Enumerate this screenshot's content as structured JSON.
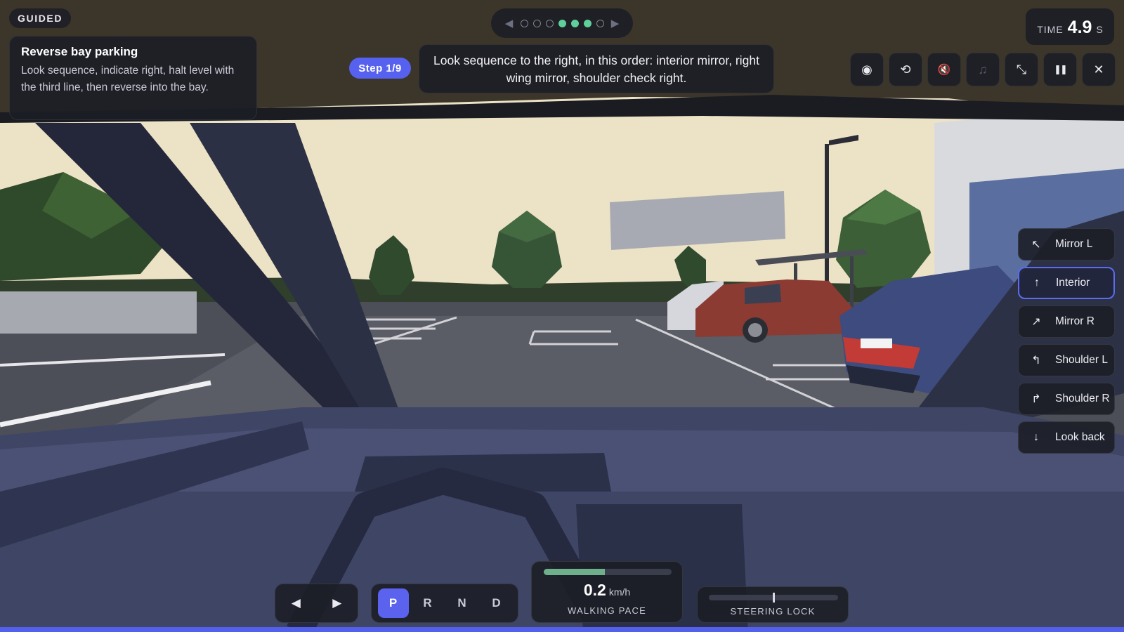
{
  "mode_label": "GUIDED",
  "task": {
    "title": "Reverse bay parking",
    "description": "Look sequence, indicate right, halt level with the third line, then reverse into the bay."
  },
  "stepper": {
    "prev_icon": "◀",
    "next_icon": "▶",
    "dots": [
      "pending",
      "pending",
      "pending",
      "done",
      "done",
      "done",
      "pending"
    ]
  },
  "step_badge": "Step 1/9",
  "instruction": "Look sequence to the right, in this order: interior mirror, right wing mirror, shoulder check right.",
  "timer": {
    "label": "TIME",
    "value": "4.9",
    "unit": "S"
  },
  "toolbar": [
    {
      "name": "camera-icon",
      "glyph": "◉",
      "dim": false
    },
    {
      "name": "reset-icon",
      "glyph": "⟲",
      "dim": false
    },
    {
      "name": "horn-muted-icon",
      "glyph": "🔇",
      "dim": false
    },
    {
      "name": "music-icon",
      "glyph": "♫",
      "dim": true
    },
    {
      "name": "collapse-icon",
      "glyph": "⤡",
      "dim": false
    },
    {
      "name": "pause-icon",
      "glyph": "❚❚",
      "dim": false
    },
    {
      "name": "close-icon",
      "glyph": "✕",
      "dim": false
    }
  ],
  "look_buttons": [
    {
      "label": "Mirror L",
      "icon": "↖",
      "active": false
    },
    {
      "label": "Interior",
      "icon": "↑",
      "active": true
    },
    {
      "label": "Mirror R",
      "icon": "↗",
      "active": false
    },
    {
      "label": "Shoulder L",
      "icon": "↰",
      "active": false
    },
    {
      "label": "Shoulder R",
      "icon": "↱",
      "active": false
    },
    {
      "label": "Look back",
      "icon": "↓",
      "active": false
    }
  ],
  "steer_arrows": {
    "left": "◀",
    "right": "▶"
  },
  "gears": {
    "items": [
      "P",
      "R",
      "N",
      "D"
    ],
    "selected": "P"
  },
  "speed": {
    "value": "0.2",
    "unit": "km/h",
    "caption": "WALKING PACE",
    "bar_fraction": 0.48
  },
  "steering": {
    "caption": "STEERING LOCK",
    "position_fraction": 0.5
  },
  "colors": {
    "accent": "#5661f0",
    "progress_done": "#5fcf9c"
  }
}
